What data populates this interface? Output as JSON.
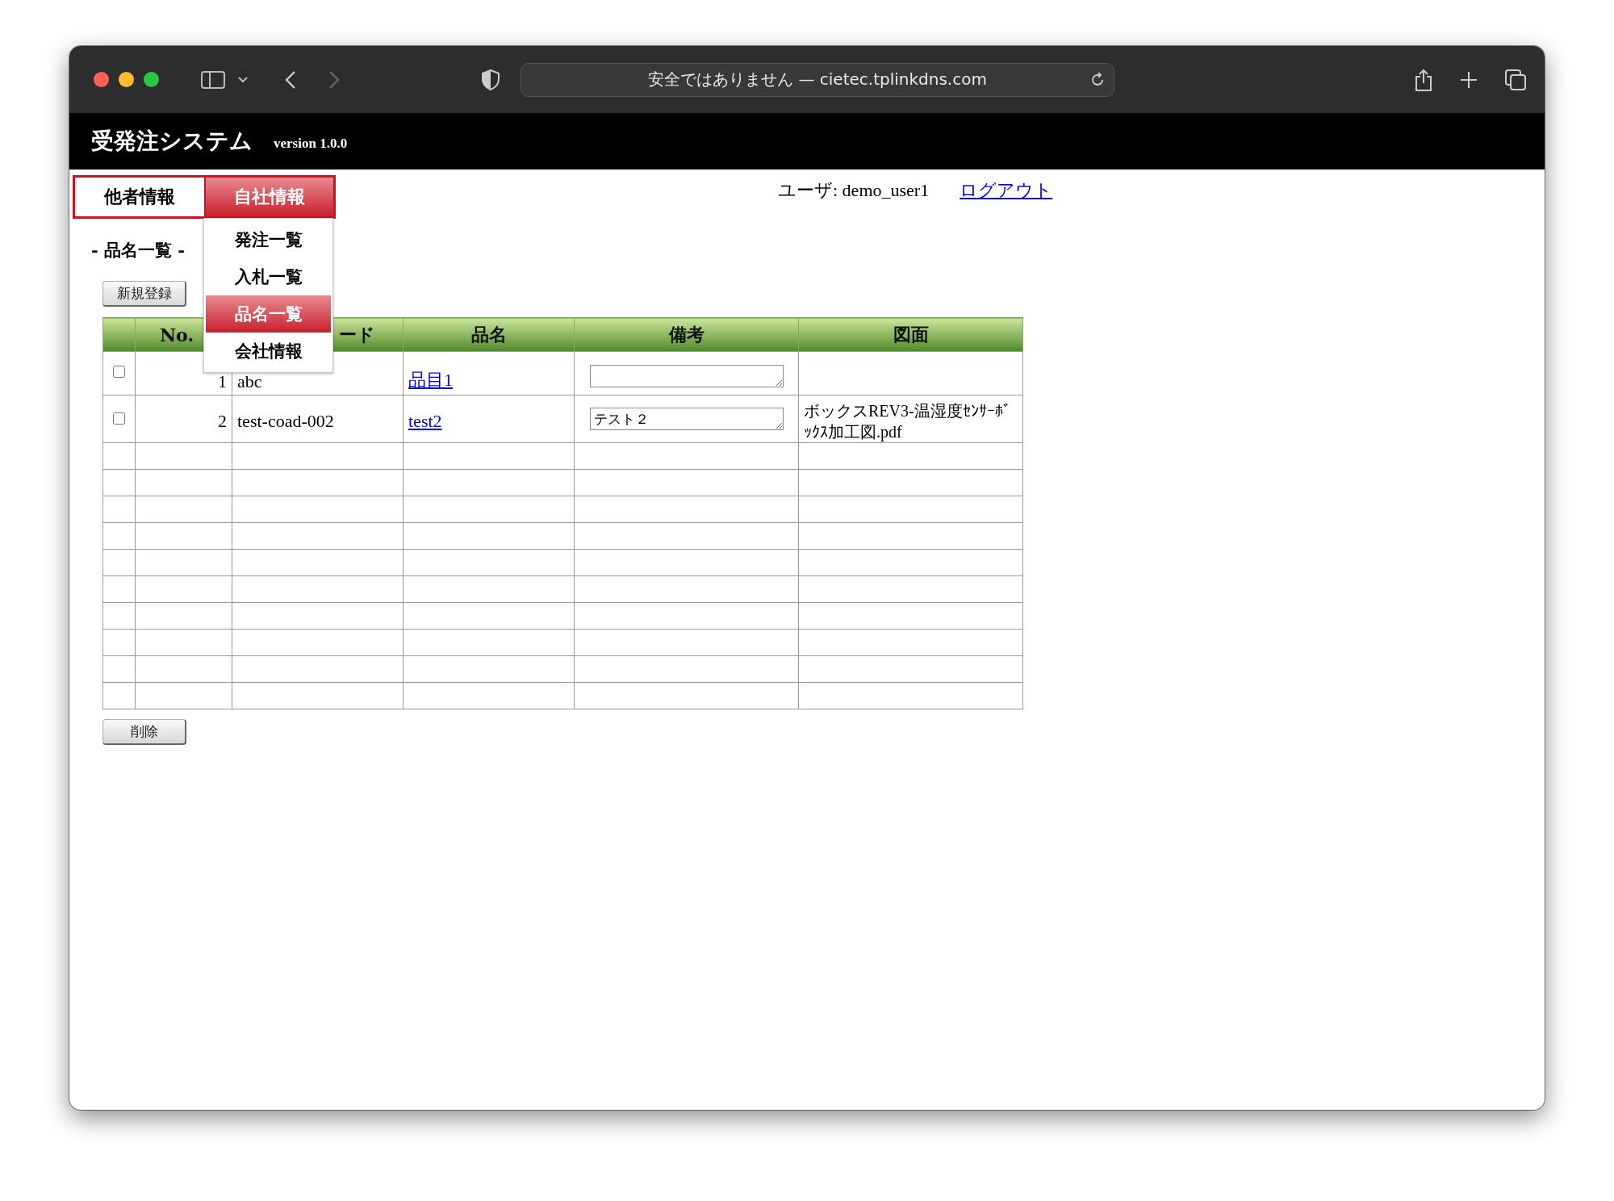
{
  "browser": {
    "url": "安全ではありません — cietec.tplinkdns.com"
  },
  "app": {
    "title": "受発注システム",
    "version": "version 1.0.0"
  },
  "tabs": [
    {
      "label": "他者情報",
      "selected": false
    },
    {
      "label": "自社情報",
      "selected": true
    }
  ],
  "menu": [
    {
      "label": "発注一覧",
      "selected": false
    },
    {
      "label": "入札一覧",
      "selected": false
    },
    {
      "label": "品名一覧",
      "selected": true
    },
    {
      "label": "会社情報",
      "selected": false
    }
  ],
  "user": {
    "label": "ユーザ: demo_user1",
    "logout": "ログアウト"
  },
  "page_title": "- 品名一覧 -",
  "new_button": "新規登録",
  "table": {
    "columns": [
      "No.",
      "ード",
      "品名",
      "備考",
      "図面"
    ],
    "rows": [
      {
        "checked": false,
        "no": "1",
        "code": "abc",
        "name": "品目1",
        "note": "",
        "drawing": ""
      },
      {
        "checked": false,
        "no": "2",
        "code": "test-coad-002",
        "name": "test2",
        "note": "テスト２",
        "drawing": "ボックスREV3-温湿度ｾﾝｻｰﾎﾞｯｸｽ加工図.pdf"
      }
    ]
  },
  "delete_button": "削除"
}
